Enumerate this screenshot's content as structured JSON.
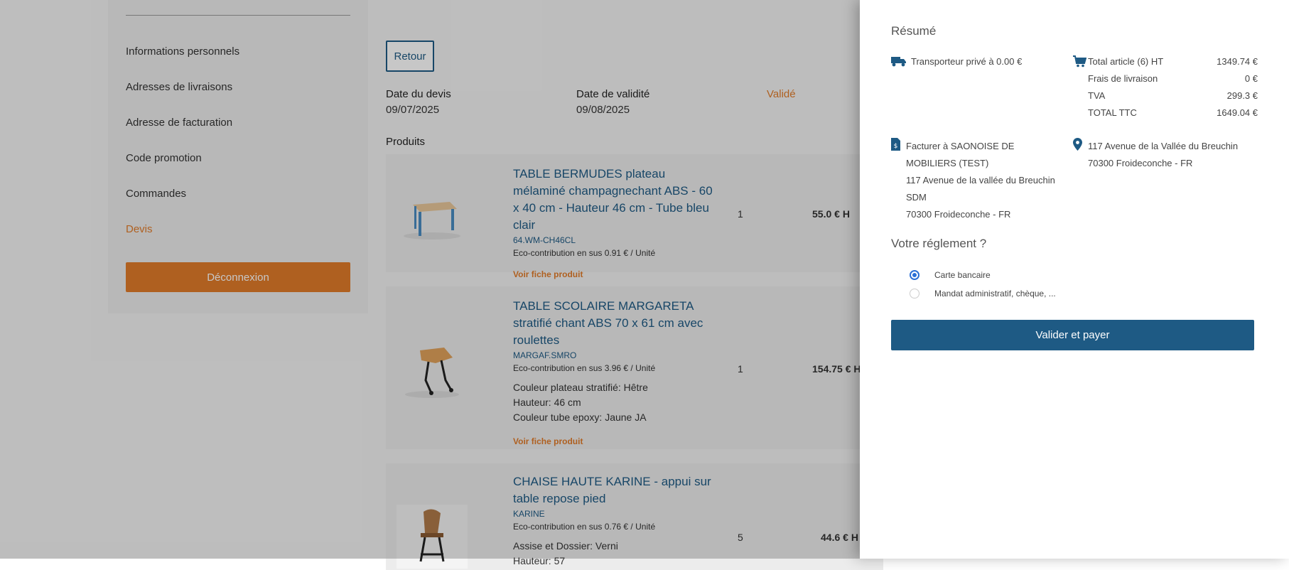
{
  "sidebar": {
    "items": [
      {
        "label": "Informations personnels"
      },
      {
        "label": "Adresses de livraisons"
      },
      {
        "label": "Adresse de facturation"
      },
      {
        "label": "Code promotion"
      },
      {
        "label": "Commandes"
      },
      {
        "label": "Devis"
      }
    ],
    "logout_label": "Déconnexion"
  },
  "main": {
    "back_label": "Retour",
    "date_quote_label": "Date du devis",
    "date_quote_value": "09/07/2025",
    "date_validity_label": "Date de validité",
    "date_validity_value": "09/08/2025",
    "status": "Validé",
    "products_title": "Produits",
    "products": [
      {
        "name": "TABLE BERMUDES plateau mélaminé champagnechant ABS - 60 x 40 cm - Hauteur 46 cm - Tube bleu clair",
        "ref": "64.WM-CH46CL",
        "eco": "Eco-contribution en sus 0.91 € / Unité",
        "attrs": [],
        "link": "Voir fiche produit",
        "qty": "1",
        "price": "55.0 € H"
      },
      {
        "name": "TABLE SCOLAIRE MARGARETA stratifié chant ABS 70 x 61 cm avec roulettes",
        "ref": "MARGAF.SMRO",
        "eco": "Eco-contribution en sus 3.96 € / Unité",
        "attrs": [
          "Couleur plateau stratifié: Hêtre",
          "Hauteur: 46 cm",
          "Couleur tube epoxy: Jaune JA"
        ],
        "link": "Voir fiche produit",
        "qty": "1",
        "price": "154.75 € H"
      },
      {
        "name": "CHAISE HAUTE KARINE - appui sur table repose pied",
        "ref": "KARINE",
        "eco": "Eco-contribution en sus 0.76 € / Unité",
        "attrs": [
          "Assise et Dossier: Verni",
          "Hauteur: 57"
        ],
        "link": "",
        "qty": "5",
        "price": "44.6 € H"
      }
    ]
  },
  "summary": {
    "title": "Résumé",
    "shipping": "Transporteur privé à 0.00 €",
    "totals": [
      {
        "label": "Total article (6) HT",
        "value": "1349.74 €"
      },
      {
        "label": "Frais de livraison",
        "value": "0 €"
      },
      {
        "label": "TVA",
        "value": "299.3 €"
      },
      {
        "label": "TOTAL TTC",
        "value": "1649.04 €"
      }
    ],
    "billing_lines": [
      "Facturer à SAONOISE DE",
      "MOBILIERS (TEST)",
      "117 Avenue de la vallée du Breuchin",
      "SDM",
      "70300 Froideconche - FR"
    ],
    "delivery_lines": [
      "117 Avenue de la Vallée du Breuchin",
      "70300 Froideconche - FR"
    ],
    "payment_title": "Votre réglement ?",
    "payment_options": [
      {
        "label": "Carte bancaire",
        "selected": true
      },
      {
        "label": "Mandat administratif, chèque, ...",
        "selected": false
      }
    ],
    "pay_button": "Valider et payer"
  },
  "icons": {
    "shipping": "truck-icon",
    "cart": "cart-icon",
    "billing": "invoice-icon",
    "delivery": "map-pin-icon"
  },
  "colors": {
    "accent": "#e07b2a",
    "primary": "#1e5a84",
    "radio": "#2a6fd6"
  }
}
